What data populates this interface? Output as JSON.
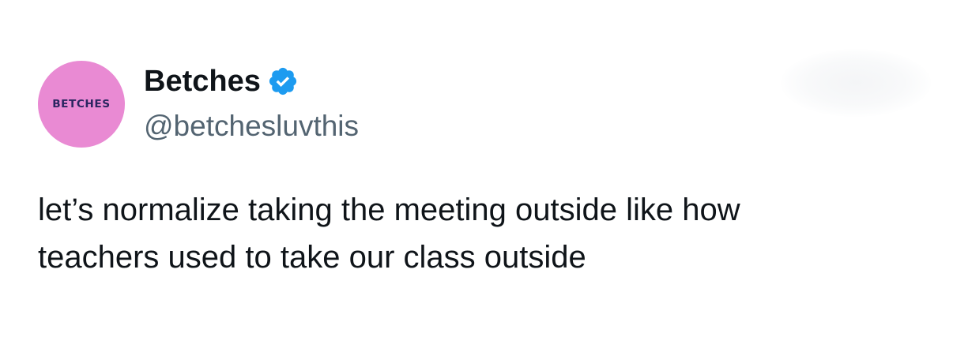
{
  "author": {
    "avatar_text": "BETCHES",
    "display_name": "Betches",
    "handle": "@betchesluvthis",
    "verified": true,
    "avatar_color": "#e98ad3",
    "avatar_text_color": "#2a2560",
    "verified_icon": "verified-badge-icon",
    "verified_color": "#1d9bf0"
  },
  "tweet": {
    "lines": [
      "let’s normalize taking the meeting outside like how",
      "teachers used to take our class outside"
    ]
  }
}
